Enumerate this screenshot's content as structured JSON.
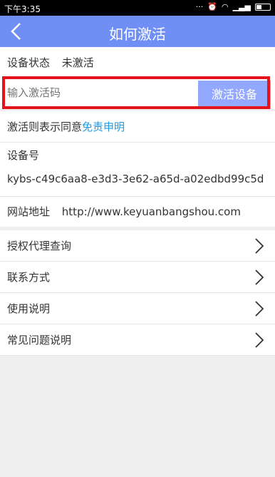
{
  "status_bar": {
    "time": "下午3:35",
    "icons": [
      "more-icon",
      "alarm-icon",
      "wifi-icon",
      "signal-icon",
      "battery-icon"
    ]
  },
  "header": {
    "title": "如何激活"
  },
  "device_status": {
    "label": "设备状态",
    "value": "未激活"
  },
  "activation": {
    "placeholder": "输入激活码",
    "button_label": "激活设备"
  },
  "agreement": {
    "prefix": "激活则表示同意",
    "link": "免责申明"
  },
  "device": {
    "label": "设备号",
    "id": "kybs-c49c6aa8-e3d3-3e62-a65d-a02edbd99c5d"
  },
  "website": {
    "label": "网站地址",
    "url": "http://www.keyuanbangshou.com"
  },
  "menu": [
    {
      "label": "授权代理查询"
    },
    {
      "label": "联系方式"
    },
    {
      "label": "使用说明"
    },
    {
      "label": "常见问题说明"
    }
  ],
  "colors": {
    "header": "#6f8ff5",
    "button": "#93a8ff",
    "link": "#1d9be6",
    "highlight": "#e5141b"
  }
}
